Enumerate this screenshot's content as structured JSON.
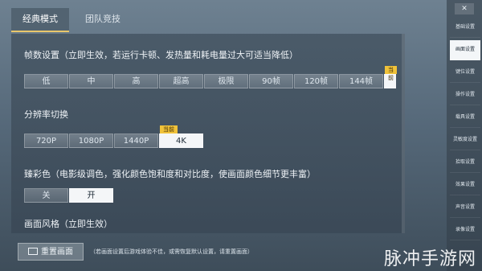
{
  "tabs": [
    {
      "label": "经典模式",
      "active": true
    },
    {
      "label": "团队竞技",
      "active": false
    }
  ],
  "sections": {
    "fps": {
      "title": "帧数设置（立即生效，若运行卡顿、发热量和耗电量过大可适当降低）",
      "options": [
        "低",
        "中",
        "高",
        "超高",
        "极限",
        "90帧",
        "120帧",
        "144帧"
      ],
      "selected": "144帧",
      "partial_tag": "当前"
    },
    "resolution": {
      "title": "分辨率切换",
      "options": [
        "720P",
        "1080P",
        "1440P",
        "4K"
      ],
      "selected": "4K",
      "tag": "当前"
    },
    "hdr": {
      "title": "臻彩色（电影级调色，强化颜色饱和度和对比度，使画面颜色细节更丰富）",
      "options": [
        "关",
        "开"
      ],
      "selected": "开"
    },
    "style": {
      "title": "画面风格（立即生效）"
    }
  },
  "footer": {
    "reset_label": "重置画面",
    "hint": "（若画面设置后游戏体验不佳，或需恢复默认设置，请重置画面）"
  },
  "sidebar": {
    "close_label": "✕",
    "items": [
      "基础设置",
      "画面设置",
      "键位设置",
      "操作设置",
      "载具设置",
      "灵敏度设置",
      "拾取设置",
      "效果设置",
      "声音设置",
      "录像设置"
    ],
    "active_index": 1
  },
  "watermark": "脉冲手游网",
  "colors": {
    "accent_tag": "#f0c23a",
    "selected_bg": "#f4f6f8",
    "tab_underline": "#e8c76b"
  }
}
